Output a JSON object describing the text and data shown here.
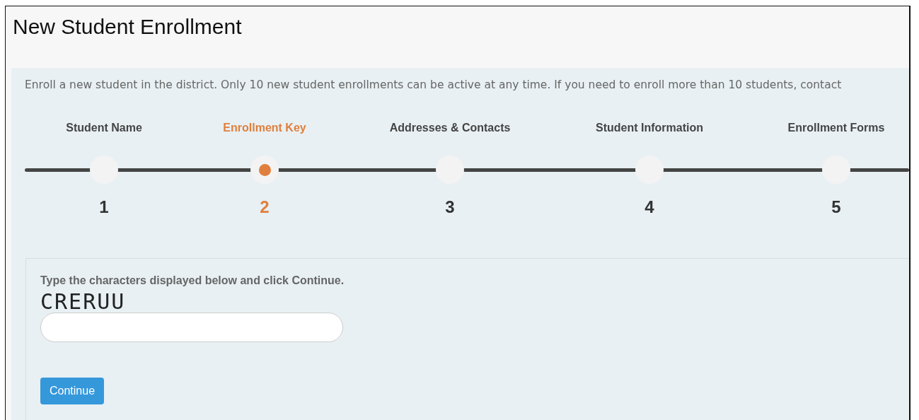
{
  "page": {
    "title": "New Student Enrollment"
  },
  "intro": "Enroll a new student in the district. Only 10 new student enrollments can be active at any time. If you need to enroll more than 10 students, contact",
  "steps": [
    {
      "label": "Student Name",
      "number": "1",
      "selected": false
    },
    {
      "label": "Enrollment Key",
      "number": "2",
      "selected": true
    },
    {
      "label": "Addresses & Contacts",
      "number": "3",
      "selected": false
    },
    {
      "label": "Student Information",
      "number": "4",
      "selected": false
    },
    {
      "label": "Enrollment Forms",
      "number": "5",
      "selected": false
    }
  ],
  "captcha": {
    "instruction": "Type the characters displayed below and click Continue.",
    "code": "CRERUU",
    "button": "Continue"
  }
}
